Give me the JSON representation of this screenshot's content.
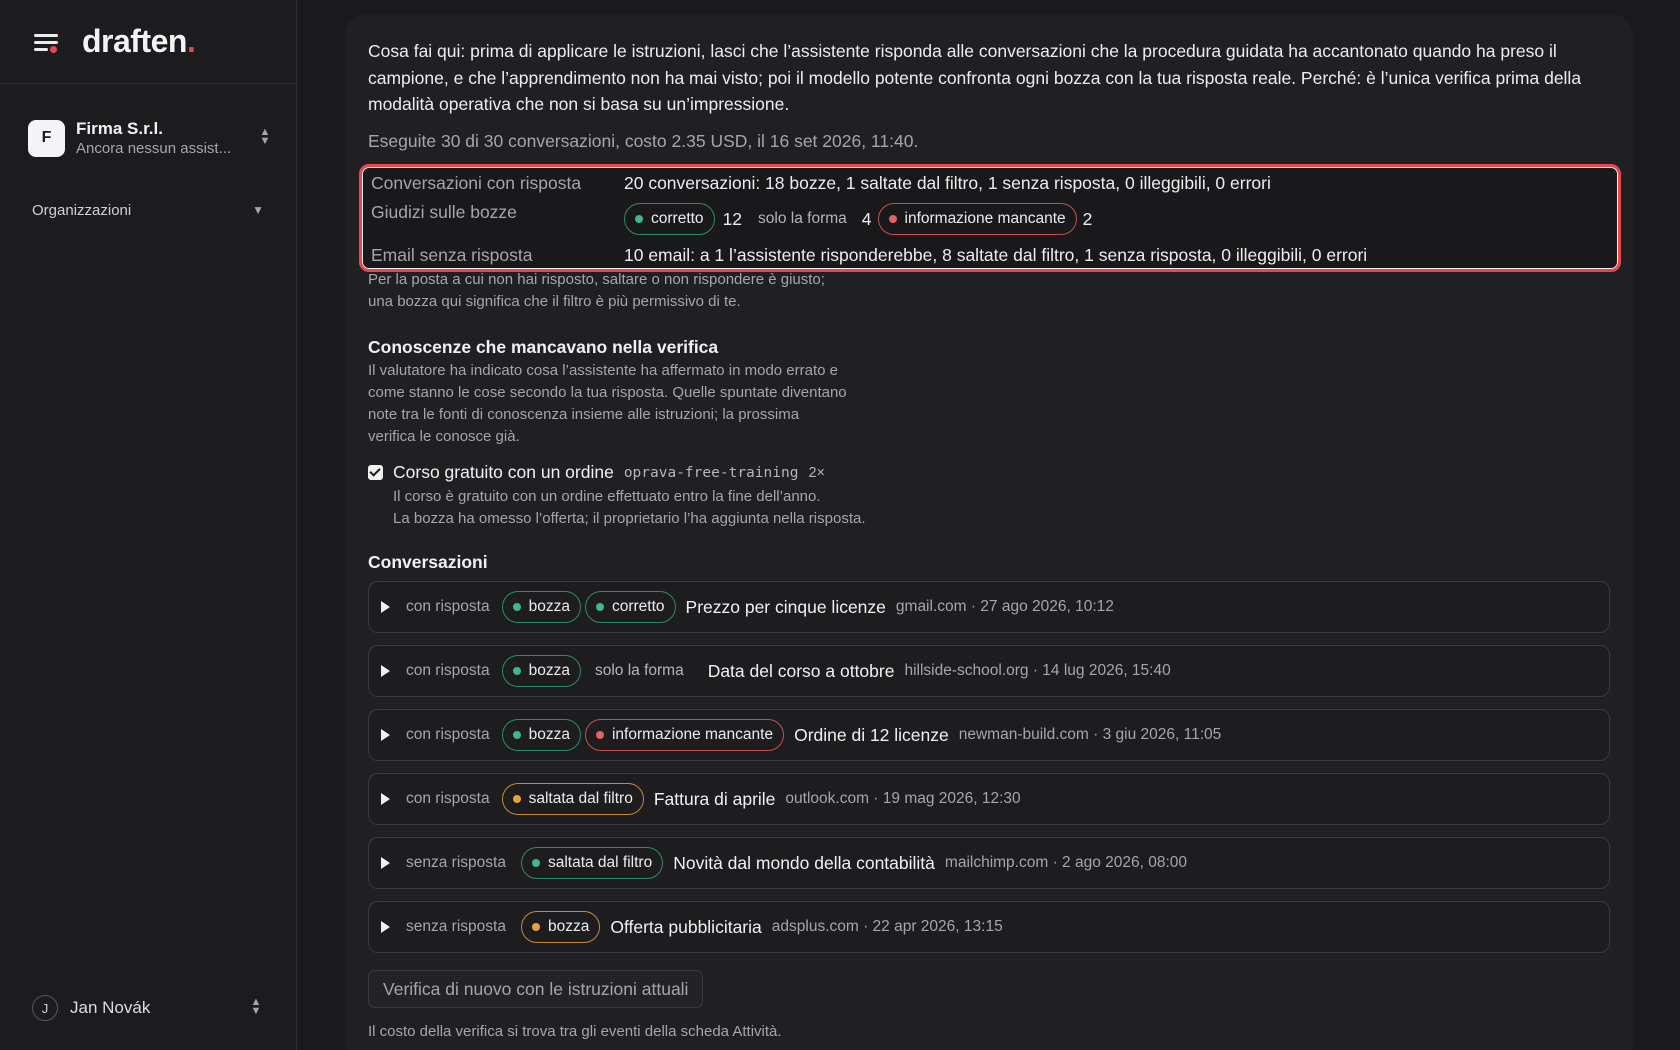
{
  "sidebar": {
    "logo_text": "draften",
    "logo_dot": ".",
    "org_initial": "F",
    "org_name": "Firma S.r.l.",
    "org_subtitle": "Ancora nessun assist...",
    "organizations_label": "Organizzazioni",
    "user_initial": "J",
    "user_name": "Jan Novák"
  },
  "verification": {
    "intro": "Cosa fai qui: prima di applicare le istruzioni, lasci che l’assistente risponda alle conversazioni che la procedura guidata ha accantonato quando ha preso il campione, e che l’apprendimento non ha mai visto; poi il modello potente confronta ogni bozza con la tua risposta reale. Perché: è l’unica verifica prima della modalità operativa che non si basa su un’impressione.",
    "run_info": "Eseguite 30 di 30 conversazioni, costo 2.35 USD, il 16 set 2026, 11:40.",
    "summary": {
      "replied_label": "Conversazioni con risposta",
      "replied_value": "20 conversazioni: 18 bozze, 1 saltate dal filtro, 1 senza risposta, 0 illeggibili, 0 errori",
      "judgements_label": "Giudizi sulle bozze",
      "correct_label": "corretto",
      "correct_count": "12",
      "form_label": "solo la forma",
      "form_count": "4",
      "missing_label": "informazione mancante",
      "missing_count": "2",
      "unreplied_label": "Email senza risposta",
      "unreplied_value": "10 email: a 1 l’assistente risponderebbe, 8 saltate dal filtro, 1 senza risposta, 0 illeggibili, 0 errori"
    },
    "unreplied_note_1": "Per la posta a cui non hai risposto, saltare o non rispondere è giusto;",
    "unreplied_note_2": "una bozza qui significa che il filtro è più permissivo di te.",
    "knowledge": {
      "title": "Conoscenze che mancavano nella verifica",
      "desc_1": "Il valutatore ha indicato cosa l’assistente ha affermato in modo errato e",
      "desc_2": "come stanno le cose secondo la tua risposta. Quelle spuntate diventano",
      "desc_3": "note tra le fonti di conoscenza insieme alle istruzioni; la prossima",
      "desc_4": "verifica le conosce già.",
      "item_title": "Corso gratuito con un ordine",
      "item_key": "oprava-free-training",
      "item_count": "2×",
      "item_checked": true,
      "item_line_1": "Il corso è gratuito con un ordine effettuato entro la fine dell’anno.",
      "item_line_2": "La bozza ha omesso l’offerta; il proprietario l’ha aggiunta nella risposta."
    },
    "conversations_title": "Conversazioni",
    "conversations": [
      {
        "status": "con risposta",
        "tag1": "bozza",
        "tag2": "corretto",
        "subject": "Prezzo per cinque licenze",
        "meta": "gmail.com · 27 ago 2026, 10:12"
      },
      {
        "status": "con risposta",
        "tag1": "bozza",
        "tag2": "solo la forma",
        "subject": "Data del corso a ottobre",
        "meta": "hillside-school.org · 14 lug 2026, 15:40"
      },
      {
        "status": "con risposta",
        "tag1": "bozza",
        "tag2": "informazione mancante",
        "subject": "Ordine di 12 licenze",
        "meta": "newman-build.com · 3 giu 2026, 11:05"
      },
      {
        "status": "con risposta",
        "tag1": "saltata dal filtro",
        "subject": "Fattura di aprile",
        "meta": "outlook.com · 19 mag 2026, 12:30"
      },
      {
        "status": "senza risposta",
        "tag1": "saltata dal filtro",
        "subject": "Novità dal mondo della contabilità",
        "meta": "mailchimp.com · 2 ago 2026, 08:00"
      },
      {
        "status": "senza risposta",
        "tag1": "bozza",
        "subject": "Offerta pubblicitaria",
        "meta": "adsplus.com · 22 apr 2026, 13:15"
      }
    ],
    "rerun_button": "Verifica di nuovo con le istruzioni attuali",
    "footer_note": "Il costo della verifica si trova tra gli eventi della scheda Attività."
  },
  "colors": {
    "highlight": "#e5484d",
    "positive": "#3fb68b",
    "negative": "#e5625e",
    "warning": "#e3a43e"
  }
}
